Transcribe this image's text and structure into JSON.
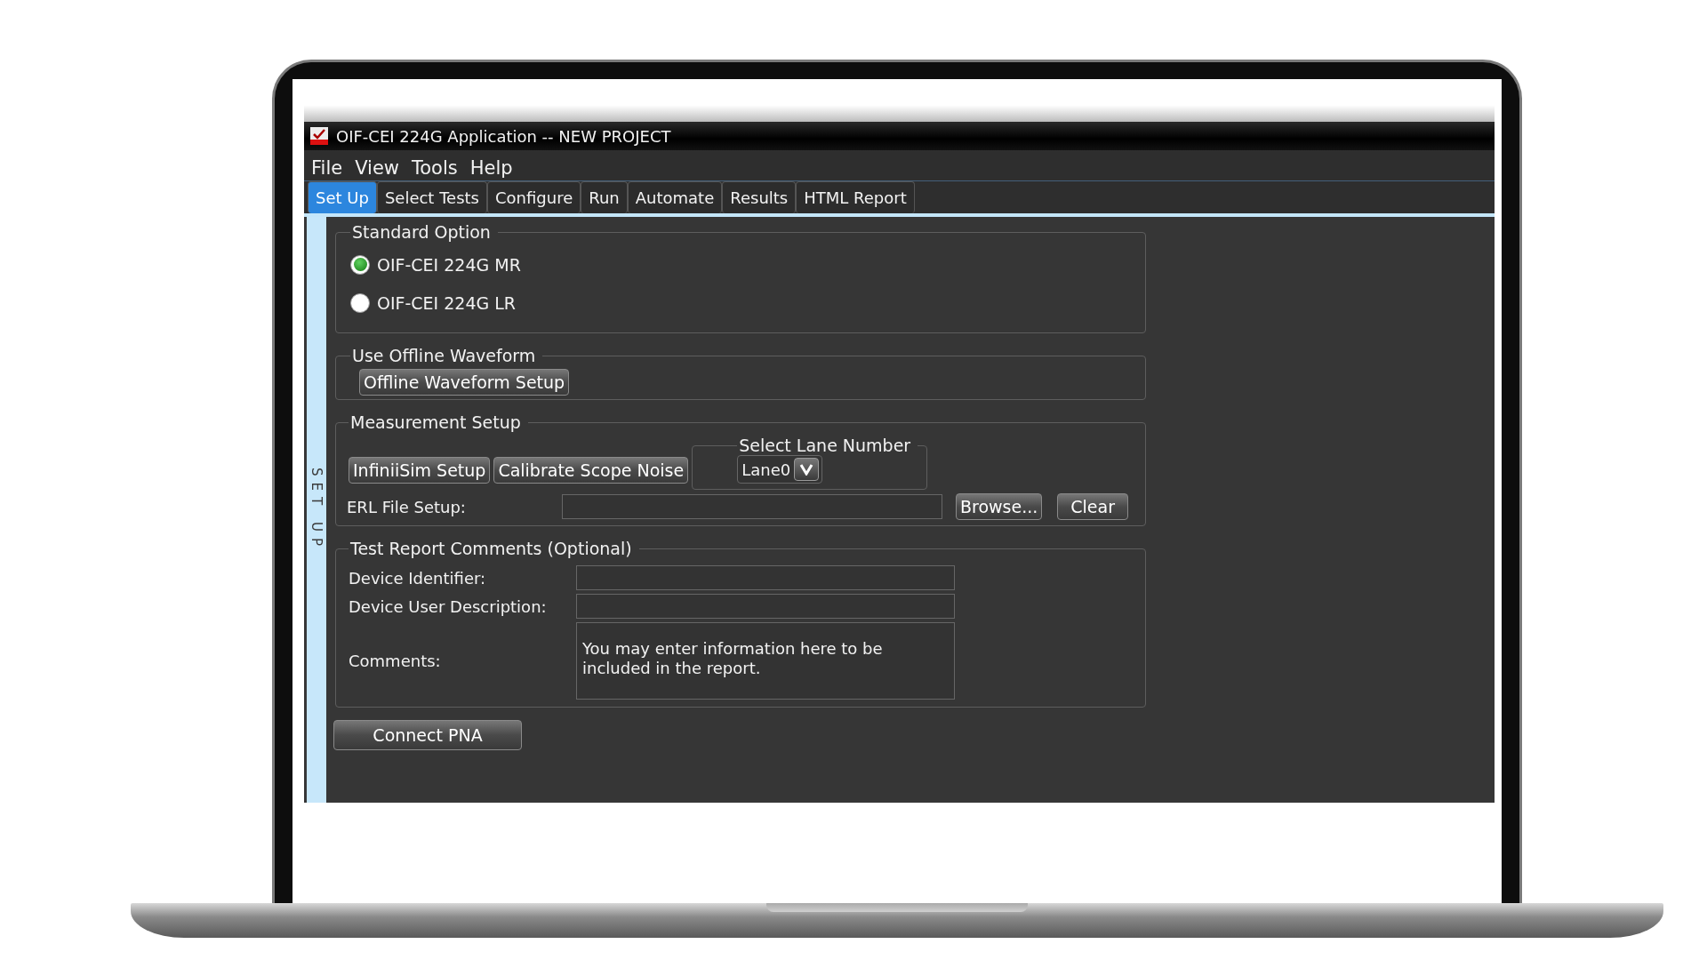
{
  "window": {
    "title": "OIF-CEI 224G Application -- NEW PROJECT"
  },
  "menu": [
    "File",
    "View",
    "Tools",
    "Help"
  ],
  "tabs": [
    {
      "label": "Set Up",
      "selected": true
    },
    {
      "label": "Select Tests",
      "selected": false
    },
    {
      "label": "Configure",
      "selected": false
    },
    {
      "label": "Run",
      "selected": false
    },
    {
      "label": "Automate",
      "selected": false
    },
    {
      "label": "Results",
      "selected": false
    },
    {
      "label": "HTML Report",
      "selected": false
    }
  ],
  "side_label": "SET UP",
  "standard_option": {
    "title": "Standard Option",
    "options": [
      {
        "label": "OIF-CEI 224G MR",
        "selected": true
      },
      {
        "label": "OIF-CEI 224G LR",
        "selected": false
      }
    ]
  },
  "offline_waveform": {
    "title": "Use Offline Waveform",
    "button": "Offline Waveform Setup"
  },
  "measurement_setup": {
    "title": "Measurement Setup",
    "buttons": [
      "InfiniiSim Setup",
      "Calibrate Scope Noise"
    ],
    "lane": {
      "title": "Select Lane Number",
      "value": "Lane0"
    },
    "erl": {
      "label": "ERL File Setup:",
      "buttons": [
        "Browse...",
        "Clear"
      ]
    }
  },
  "report_comments": {
    "title": "Test Report Comments (Optional)",
    "fields": [
      {
        "label": "Device Identifier:",
        "kind": "line"
      },
      {
        "label": "Device User Description:",
        "kind": "line"
      },
      {
        "label": "Comments:",
        "kind": "multiline",
        "value": "You may enter information here to be included in the report."
      }
    ]
  },
  "connect_button": "Connect PNA"
}
